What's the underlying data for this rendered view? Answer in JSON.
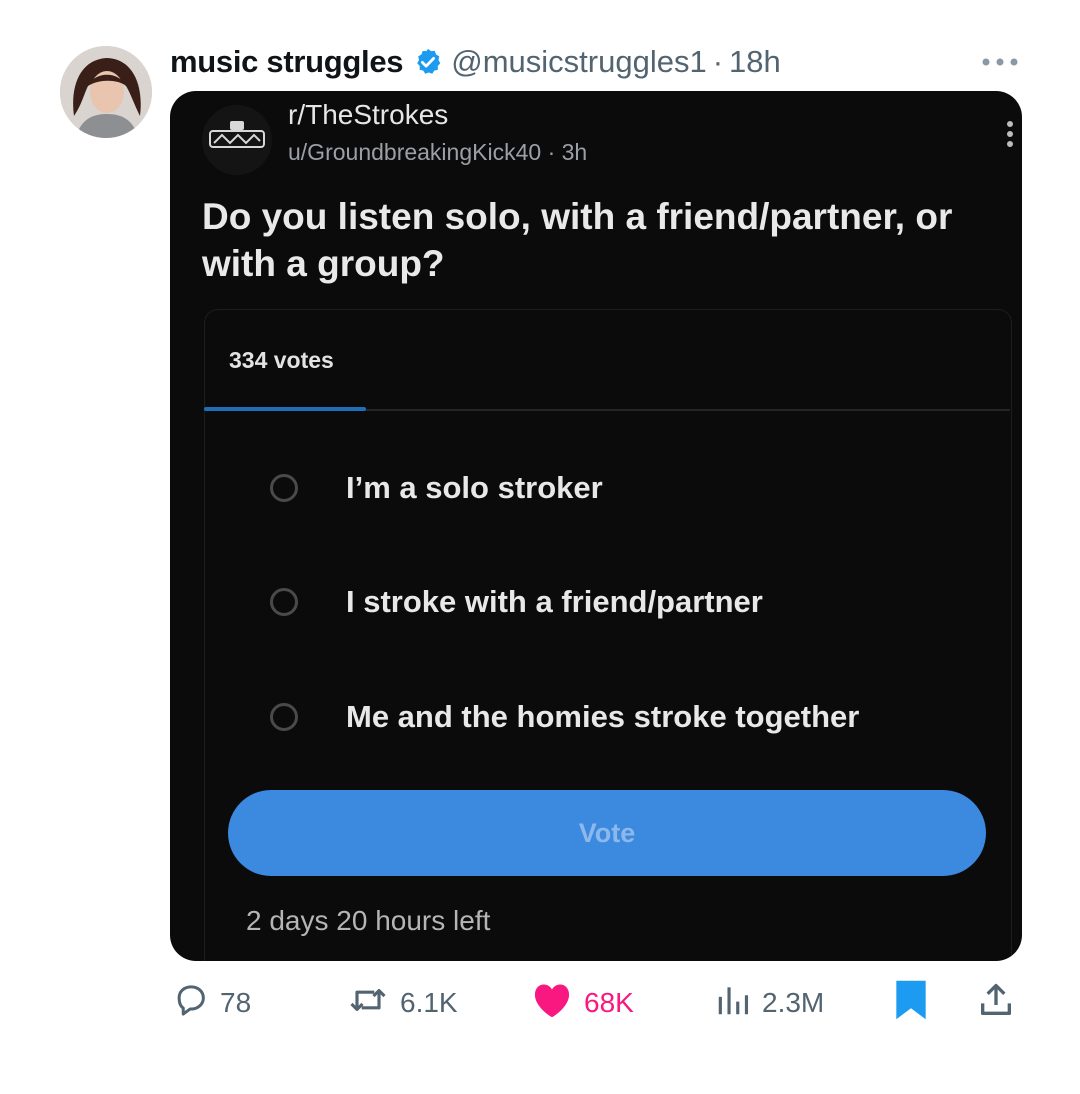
{
  "tweet": {
    "display_name": "music struggles",
    "handle": "@musicstruggles1",
    "separator": "·",
    "time": "18h"
  },
  "embed": {
    "subreddit": "r/TheStrokes",
    "author": "u/GroundbreakingKick40",
    "author_separator": "·",
    "posted": "3h",
    "question": "Do you listen solo, with a friend/partner, or with a group?",
    "poll": {
      "votes": "334 votes",
      "options": [
        {
          "label": "I’m a solo stroker",
          "selected": false
        },
        {
          "label": "I stroke with a friend/partner",
          "selected": false
        },
        {
          "label": "Me and the homies stroke together",
          "selected": false
        }
      ],
      "vote_label": "Vote",
      "time_left": "2 days 20 hours left"
    }
  },
  "actions": {
    "replies": "78",
    "reposts": "6.1K",
    "likes": "68K",
    "views": "2.3M",
    "liked": true,
    "bookmarked": true
  },
  "colors": {
    "verified": "#1d9bf0",
    "like": "#f91880",
    "bookmark": "#1d9bf0",
    "vote_button": "#3b8ae0",
    "tab_indicator": "#1f6fb8"
  }
}
